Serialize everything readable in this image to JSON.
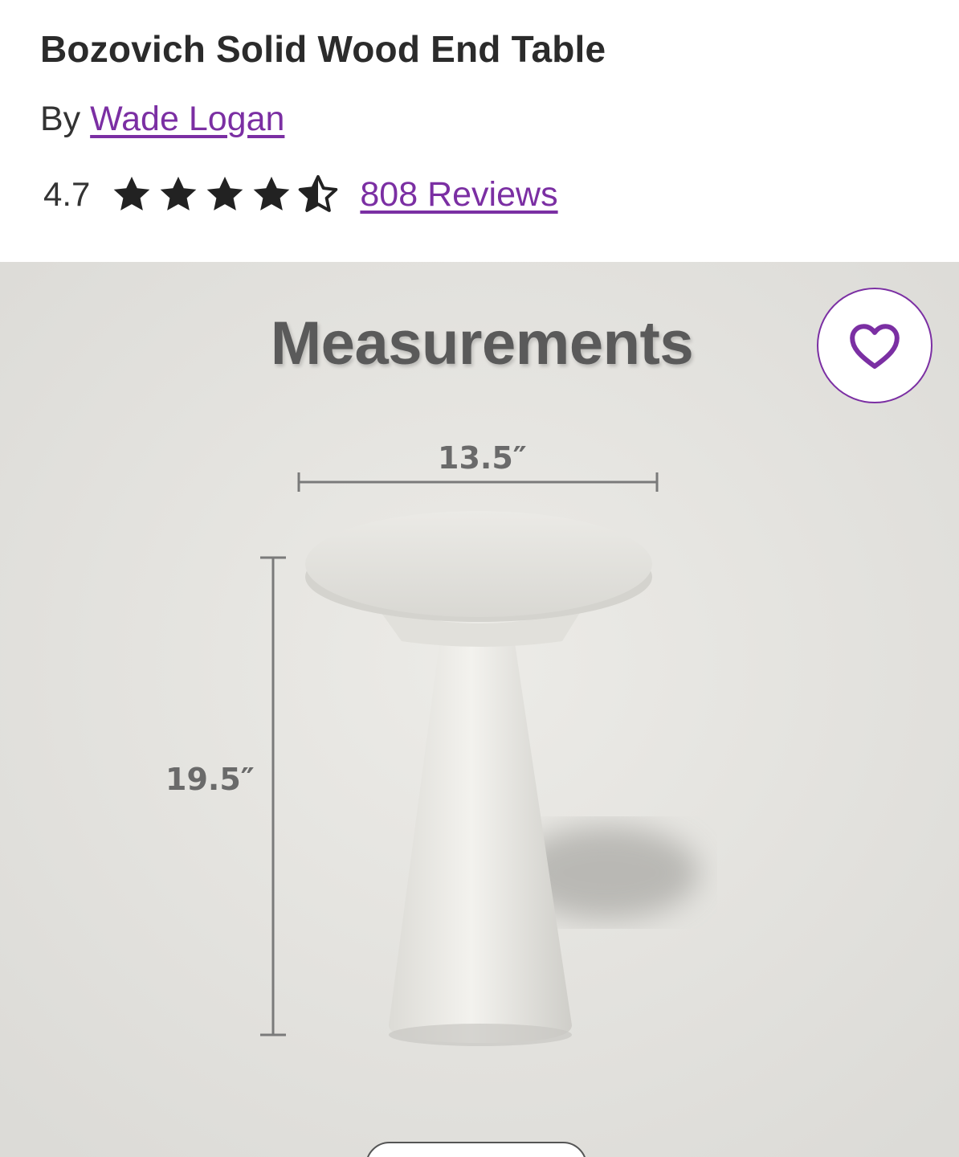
{
  "product": {
    "title": "Bozovich Solid Wood End Table",
    "by_prefix": "By",
    "brand": "Wade Logan",
    "rating": "4.7",
    "rating_fraction": 0.94,
    "reviews_link": "808 Reviews"
  },
  "image": {
    "heading": "Measurements",
    "width_label": "13.5″",
    "height_label": "19.5″"
  },
  "icons": {
    "favorite": "heart-outline-icon",
    "star": "star-icon"
  },
  "colors": {
    "accent": "#7b2fa3",
    "text": "#2b2b2b",
    "image_background": "#e6e5e1"
  }
}
